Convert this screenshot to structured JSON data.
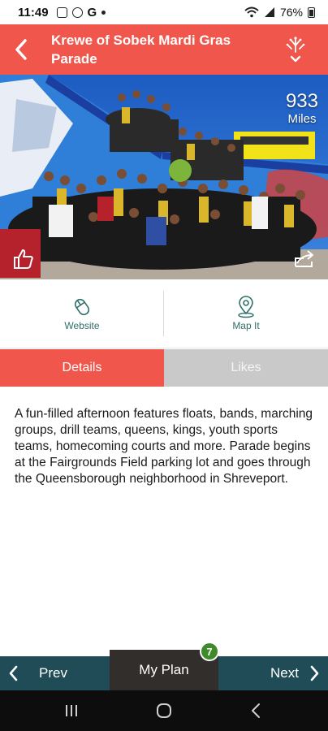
{
  "status": {
    "time": "11:49",
    "g_letter": "G",
    "battery": "76%"
  },
  "header": {
    "title": "Krewe of Sobek Mardi Gras Parade"
  },
  "hero": {
    "distance_value": "933",
    "distance_unit": "Miles"
  },
  "actions": {
    "website_label": "Website",
    "map_label": "Map It"
  },
  "tabs": {
    "details_label": "Details",
    "likes_label": "Likes"
  },
  "description": "A fun-filled afternoon features floats, bands, marching groups, drill teams, queens, kings, youth sports teams, homecoming courts and more. Parade begins at the Fairgrounds Field parking lot and goes through the Queensborough neighborhood in Shreveport.",
  "bottom": {
    "prev_label": "Prev",
    "myplan_label": "My Plan",
    "myplan_count": "7",
    "next_label": "Next"
  },
  "colors": {
    "accent": "#f0564b",
    "nav": "#1f4c56",
    "teal_text": "#2f6f6a",
    "badge": "#3f8a2a"
  },
  "icons": [
    "back-chevron-icon",
    "share-burst-icon",
    "thumbs-up-icon",
    "share-arrow-icon",
    "mouse-icon",
    "map-pin-icon",
    "chevron-left-icon",
    "chevron-right-icon"
  ]
}
